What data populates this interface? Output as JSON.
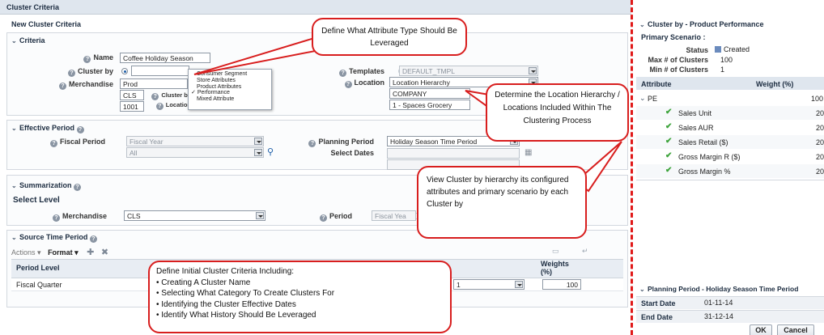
{
  "page": {
    "title": "Cluster Criteria",
    "subtitle": "New Cluster Criteria"
  },
  "criteria": {
    "heading": "Criteria",
    "name_label": "Name",
    "name_value": "Coffee Holiday Season",
    "cluster_by_label": "Cluster by",
    "merchandise_label": "Merchandise",
    "merchandise_value": "Prod",
    "merch_row2": "CLS",
    "merch_row3": "1001",
    "templates_label": "Templates",
    "templates_value": "DEFAULT_TMPL",
    "location_label": "Location",
    "location_value": "Location Hierarchy",
    "location_row2": "COMPANY",
    "location_row3": "1 - Spaces Grocery",
    "inner_cluster_by_label": "Cluster by",
    "inner_location_label": "Location"
  },
  "cluster_by_menu": {
    "items": [
      "Consumer Segment",
      "Store Attributes",
      "Product Attributes",
      "Performance",
      "Mixed Attribute"
    ],
    "checked": "Performance"
  },
  "effective_period": {
    "heading": "Effective Period",
    "fiscal_label": "Fiscal Period",
    "fiscal_value": "Fiscal Year",
    "fiscal_value2": "All",
    "planning_label": "Planning Period",
    "planning_value": "Holiday Season Time Period",
    "select_dates_label": "Select Dates"
  },
  "summarization": {
    "heading": "Summarization",
    "select_level": "Select Level",
    "merch_label": "Merchandise",
    "merch_value": "CLS",
    "period_label": "Period",
    "period_value": "Fiscal Yea"
  },
  "source_time_period": {
    "heading": "Source Time Period",
    "actions": "Actions",
    "format": "Format",
    "col_period_level": "Period Level",
    "col_weights": "Weights",
    "col_weights_unit": "(%)",
    "row_period_level": "Fiscal Quarter",
    "row_mid_value": "1",
    "row_weight": "100"
  },
  "right_panel": {
    "heading": "Cluster by - Product Performance",
    "primary_scenario": "Primary Scenario :",
    "status_label": "Status",
    "status_value": "Created",
    "max_label": "Max # of Clusters",
    "max_value": "100",
    "min_label": "Min # of Clusters",
    "min_value": "1",
    "col_attribute": "Attribute",
    "col_weight": "Weight (%)",
    "rows": [
      {
        "name": "PE",
        "weight": "100"
      },
      {
        "name": "Sales Unit",
        "weight": "20"
      },
      {
        "name": "Sales AUR",
        "weight": "20"
      },
      {
        "name": "Sales Retail ($)",
        "weight": "20"
      },
      {
        "name": "Gross Margin R ($)",
        "weight": "20"
      },
      {
        "name": "Gross Margin %",
        "weight": "20"
      }
    ],
    "planning_heading": "Planning Period - Holiday Season Time Period",
    "start_label": "Start Date",
    "start_value": "01-11-14",
    "end_label": "End Date",
    "end_value": "31-12-14",
    "ok_label": "OK",
    "cancel_label": "Cancel"
  },
  "callouts": {
    "attribute_type": "Define What Attribute Type Should Be Leveraged",
    "location": "Determine the Location Hierarchy / Locations Included Within The Clustering Process",
    "cluster_view": "View Cluster by hierarchy its configured attributes and primary scenario by each Cluster by",
    "criteria_title": "Define Initial Cluster Criteria Including:",
    "criteria_items": [
      "Creating A Cluster Name",
      "Selecting What Category To Create Clusters For",
      "Identifying the Cluster Effective Dates",
      "Identify What History Should Be Leveraged"
    ]
  },
  "colors": {
    "callout_border": "#d81e1e",
    "check": "#3ca33a",
    "accent": "#1d5ea8"
  }
}
